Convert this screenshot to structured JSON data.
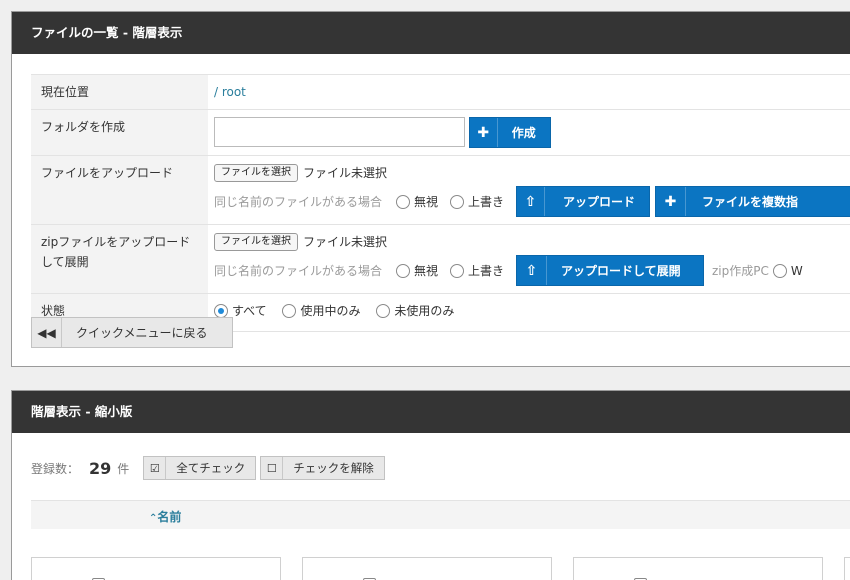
{
  "panel1": {
    "title": "ファイルの一覧 - 階層表示",
    "location": {
      "label": "現在位置",
      "slash": "/",
      "path": "root"
    },
    "create_folder": {
      "label": "フォルダを作成",
      "input_value": "",
      "button": "作成"
    },
    "upload": {
      "label": "ファイルをアップロード",
      "choose_button": "ファイルを選択",
      "no_file": "ファイル未選択",
      "same_name_text": "同じ名前のファイルがある場合",
      "options": [
        "無視",
        "上書き"
      ],
      "upload_button": "アップロード",
      "multi_button": "ファイルを複数指"
    },
    "zip_upload": {
      "label": "zipファイルをアップロードして展開",
      "choose_button": "ファイルを選択",
      "no_file": "ファイル未選択",
      "same_name_text": "同じ名前のファイルがある場合",
      "options": [
        "無視",
        "上書き"
      ],
      "upload_button": "アップロードして展開",
      "zip_label": "zip作成PC",
      "extra_option": "W"
    },
    "status": {
      "label": "状態",
      "options": [
        "すべて",
        "使用中のみ",
        "未使用のみ"
      ],
      "selected": "すべて"
    },
    "back_button": "クイックメニューに戻る"
  },
  "panel2": {
    "title": "階層表示 - 縮小版",
    "count_label": "登録数：",
    "count": "29",
    "count_unit": "件",
    "check_all": "全てチェック",
    "uncheck": "チェックを解除",
    "sort_label": "名前"
  },
  "icons": {
    "plus": "plus-icon",
    "upload": "upload-icon",
    "back": "double-chevron-left-icon",
    "checked": "checkbox-checked-icon",
    "unchecked": "checkbox-empty-icon",
    "sort": "chevron-up-icon"
  },
  "colors": {
    "header": "#343434",
    "primary": "#0b75c2",
    "link": "#2a7e9c"
  }
}
